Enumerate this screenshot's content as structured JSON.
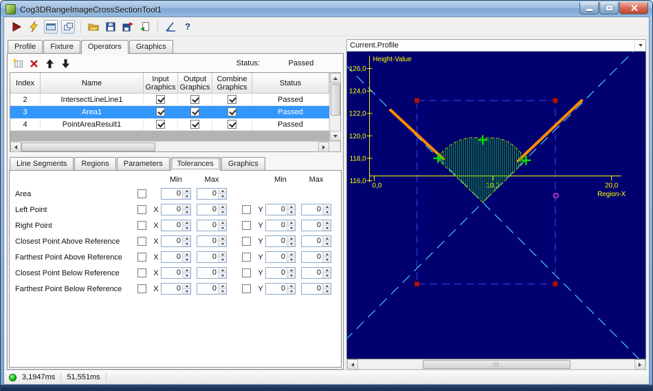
{
  "window": {
    "title": "Cog3DRangeImageCrossSectionTool1",
    "controls": [
      "minimize",
      "maximize",
      "close"
    ]
  },
  "main_toolbar": {
    "buttons": [
      "run",
      "trigger",
      "image-display",
      "organize-windows",
      "open",
      "save",
      "save-as",
      "import",
      "angle-measure",
      "help"
    ],
    "help_label": "?"
  },
  "tabs": {
    "items": [
      "Profile",
      "Fixture",
      "Operators",
      "Graphics"
    ],
    "active": "Operators"
  },
  "operators": {
    "toolbar": {
      "buttons": [
        "add-operator",
        "delete-operator",
        "move-up",
        "move-down"
      ],
      "status_label": "Status:",
      "status_value": "Passed"
    },
    "grid": {
      "columns": [
        "Index",
        "Name",
        "Input Graphics",
        "Output Graphics",
        "Combine Graphics",
        "Status"
      ],
      "rows": [
        {
          "index": "2",
          "name": "IntersectLineLine1",
          "input_graphics": true,
          "output_graphics": true,
          "combine_graphics": true,
          "status": "Passed",
          "selected": false
        },
        {
          "index": "3",
          "name": "Area1",
          "input_graphics": true,
          "output_graphics": true,
          "combine_graphics": true,
          "status": "Passed",
          "selected": true
        },
        {
          "index": "4",
          "name": "PointAreaResult1",
          "input_graphics": true,
          "output_graphics": true,
          "combine_graphics": true,
          "status": "Passed",
          "selected": false
        }
      ]
    }
  },
  "sub_tabs": {
    "items": [
      "Line Segments",
      "Regions",
      "Parameters",
      "Tolerances",
      "Graphics"
    ],
    "active": "Tolerances"
  },
  "tolerances": {
    "col_headers": [
      "Min",
      "Max",
      "Min",
      "Max"
    ],
    "x_label": "X",
    "y_label": "Y",
    "spin_value": "0",
    "rows": [
      {
        "label": "Area",
        "has_xy": false
      },
      {
        "label": "Left Point",
        "has_xy": true
      },
      {
        "label": "Right Point",
        "has_xy": true
      },
      {
        "label": "Closest Point Above Reference",
        "has_xy": true
      },
      {
        "label": "Farthest Point Above Reference",
        "has_xy": true
      },
      {
        "label": "Closest Point Below Reference",
        "has_xy": true
      },
      {
        "label": "Farthest Point Below Reference",
        "has_xy": true
      }
    ]
  },
  "display": {
    "selector_value": "Current.Profile",
    "chart_data": {
      "type": "line",
      "title": "Current.Profile",
      "xlabel": "Region-X",
      "ylabel": "Height-Value",
      "x_ticks": [
        "0,0",
        "10,0",
        "20,0"
      ],
      "y_ticks": [
        "126,0",
        "124,0",
        "122,0",
        "120,0",
        "118,0",
        "116,0"
      ],
      "xlim": [
        0,
        20
      ],
      "ylim": [
        116,
        126
      ],
      "series": [
        {
          "name": "profile-left-segment",
          "color": "#ff8a00",
          "points": [
            [
              1.5,
              122.7
            ],
            [
              5.9,
              117.9
            ]
          ]
        },
        {
          "name": "profile-right-segment",
          "color": "#ff8a00",
          "points": [
            [
              12.6,
              117.8
            ],
            [
              17.9,
              122.9
            ]
          ]
        }
      ],
      "markers": [
        {
          "name": "left-point",
          "color": "#00e000",
          "x": 5.6,
          "y": 117.9
        },
        {
          "name": "top-point",
          "color": "#00e000",
          "x": 9.1,
          "y": 119.5
        },
        {
          "name": "right-point",
          "color": "#00e000",
          "x": 13.0,
          "y": 117.8
        },
        {
          "name": "reference-point",
          "color": "#d23bd2",
          "x": 15.3,
          "y": 114.6
        }
      ],
      "region": {
        "name": "search-region",
        "x_range": [
          3.6,
          15.3
        ],
        "y_range": [
          106.9,
          123.3
        ],
        "color": "#2636cf"
      },
      "area": {
        "name": "cross-section-area",
        "fill": "green-hatch",
        "vertex": [
          9.1,
          114.1
        ]
      }
    }
  },
  "statusbar": {
    "time1": "3,1947ms",
    "time2": "51,551ms"
  }
}
